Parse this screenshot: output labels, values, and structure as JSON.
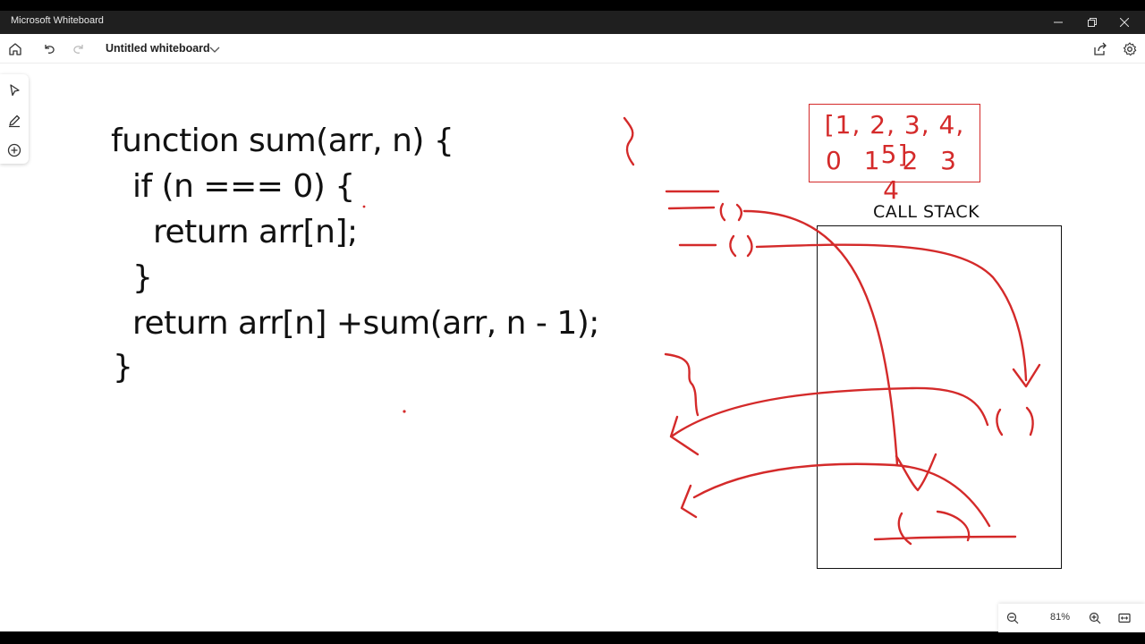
{
  "window": {
    "title": "Microsoft Whiteboard"
  },
  "toolbar": {
    "board_title": "Untitled whiteboard",
    "icons": [
      "home-icon",
      "undo-icon",
      "redo-icon",
      "chevron-down-icon",
      "share-icon",
      "settings-icon"
    ]
  },
  "sidebar": {
    "tools": [
      "select-tool-icon",
      "pen-tool-icon",
      "add-icon"
    ]
  },
  "code": {
    "lines": [
      "function sum(arr, n) {",
      "if (n === 0) {",
      "return arr[n];",
      "}",
      "return arr[n] +sum(arr, n - 1);",
      "}"
    ]
  },
  "diagram": {
    "array_values": "[1, 2, 3, 4, 5]",
    "array_indices": "0 1 2 3 4",
    "call_stack_label": "CALL STACK",
    "ink_color": "#d42a2a"
  },
  "zoom": {
    "level": "81%"
  }
}
